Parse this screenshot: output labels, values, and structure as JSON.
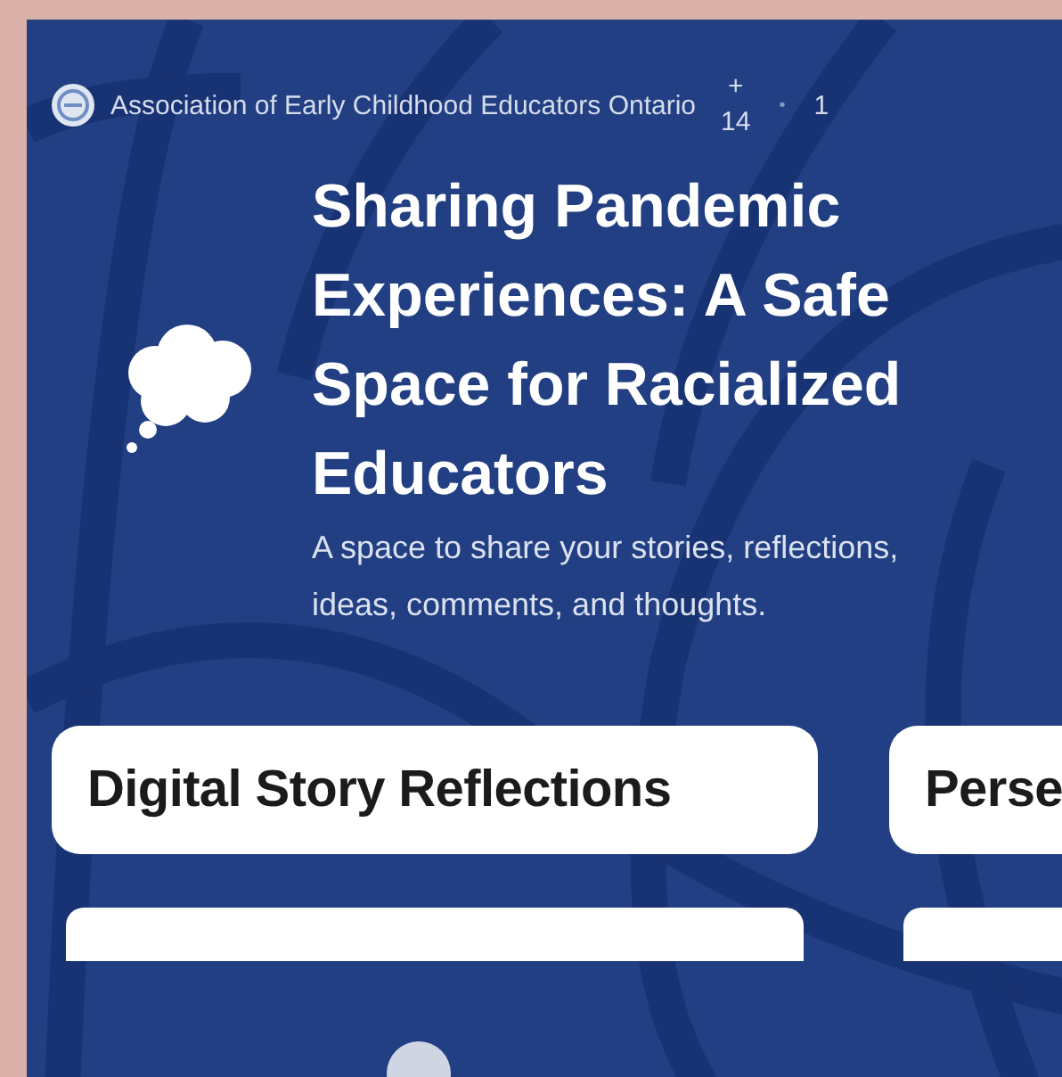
{
  "header": {
    "organization": "Association of Early Childhood Educators Ontario",
    "plus": "+",
    "member_count": "14",
    "separator": "•",
    "time": "1"
  },
  "hero": {
    "title": "Sharing Pandemic Experiences: A Safe Space for Racialized Educators",
    "description": "A space to share your stories, reflections, ideas, comments, and thoughts."
  },
  "columns": [
    {
      "title": "Digital Story Reflections"
    },
    {
      "title": "Perse"
    }
  ]
}
